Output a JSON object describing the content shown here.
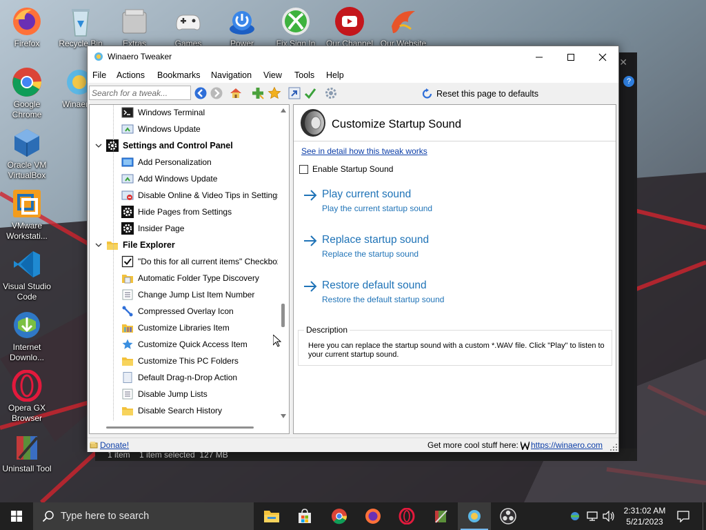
{
  "desktop": {
    "icons": [
      {
        "label": "Firefox",
        "icon": "firefox-icon"
      },
      {
        "label": "Recycle Bin",
        "icon": "recycle-bin-icon"
      },
      {
        "label": "Extras",
        "icon": "extras-icon"
      },
      {
        "label": "Games",
        "icon": "games-icon"
      },
      {
        "label": "Power",
        "icon": "power-icon"
      },
      {
        "label": "Fix Sign In",
        "icon": "xbox-icon"
      },
      {
        "label": "Our Channel",
        "icon": "youtube-icon"
      },
      {
        "label": "Our Website",
        "icon": "phoenix-icon"
      },
      {
        "label": "Google Chrome",
        "icon": "chrome-icon"
      },
      {
        "label": "Winaero Tweaker",
        "icon": "winaero-icon"
      },
      {
        "label": "Oracle VM VirtualBox",
        "icon": "virtualbox-icon"
      },
      {
        "label": "VMware Workstati...",
        "icon": "vmware-icon"
      },
      {
        "label": "Visual Studio Code",
        "icon": "vscode-icon"
      },
      {
        "label": "Internet Downlo...",
        "icon": "idm-icon"
      },
      {
        "label": "Opera GX Browser",
        "icon": "opera-gx-icon"
      },
      {
        "label": "Uninstall Tool",
        "icon": "uninstall-tool-icon"
      }
    ]
  },
  "background_window": {
    "status": "1 item    1 item selected  127 MB"
  },
  "window": {
    "title": "Winaero Tweaker",
    "menu": [
      "File",
      "Actions",
      "Bookmarks",
      "Navigation",
      "View",
      "Tools",
      "Help"
    ],
    "search_placeholder": "Search for a tweak...",
    "reset_label": "Reset this page to defaults",
    "tree": [
      {
        "label": "Windows Terminal",
        "type": "item",
        "icon": "terminal-icon"
      },
      {
        "label": "Windows Update",
        "type": "item",
        "icon": "windows-update-icon"
      },
      {
        "label": "Settings and Control Panel",
        "type": "category",
        "icon": "gear-icon"
      },
      {
        "label": "Add Personalization",
        "type": "item",
        "icon": "personalization-icon"
      },
      {
        "label": "Add Windows Update",
        "type": "item",
        "icon": "windows-update-icon"
      },
      {
        "label": "Disable Online & Video Tips in Settings",
        "type": "item",
        "icon": "tips-icon"
      },
      {
        "label": "Hide Pages from Settings",
        "type": "item",
        "icon": "gear-icon"
      },
      {
        "label": "Insider Page",
        "type": "item",
        "icon": "gear-icon"
      },
      {
        "label": "File Explorer",
        "type": "category",
        "icon": "folder-icon"
      },
      {
        "label": "\"Do this for all current items\" Checkbox",
        "type": "item",
        "icon": "checkbox-icon"
      },
      {
        "label": "Automatic Folder Type Discovery",
        "type": "item",
        "icon": "folder-discovery-icon"
      },
      {
        "label": "Change Jump List Item Number",
        "type": "item",
        "icon": "list-icon"
      },
      {
        "label": "Compressed Overlay Icon",
        "type": "item",
        "icon": "compressed-icon"
      },
      {
        "label": "Customize Libraries Item",
        "type": "item",
        "icon": "libraries-icon"
      },
      {
        "label": "Customize Quick Access Item",
        "type": "item",
        "icon": "star-icon"
      },
      {
        "label": "Customize This PC Folders",
        "type": "item",
        "icon": "folder-icon"
      },
      {
        "label": "Default Drag-n-Drop Action",
        "type": "item",
        "icon": "page-icon"
      },
      {
        "label": "Disable Jump Lists",
        "type": "item",
        "icon": "list-icon"
      },
      {
        "label": "Disable Search History",
        "type": "item",
        "icon": "folder-icon"
      }
    ],
    "page": {
      "title": "Customize Startup Sound",
      "detail_link": "See in detail how this tweak works",
      "enable_label": "Enable Startup Sound",
      "enable_checked": false,
      "actions": [
        {
          "title": "Play current sound",
          "subtitle": "Play the current startup sound"
        },
        {
          "title": "Replace startup sound",
          "subtitle": "Replace the startup sound"
        },
        {
          "title": "Restore default sound",
          "subtitle": "Restore the default startup sound"
        }
      ],
      "description_label": "Description",
      "description": "Here you can replace the startup sound with a custom *.WAV file. Click \"Play\" to listen to your current startup sound."
    },
    "status": {
      "donate": "Donate!",
      "more": "Get more cool stuff here:",
      "link": "https://winaero.com"
    }
  },
  "taskbar": {
    "search_placeholder": "Type here to search",
    "time": "2:31:02 AM",
    "date": "5/21/2023"
  },
  "colors": {
    "accent_link": "#1f73b7",
    "hyperlink": "#0c3ea8",
    "taskbar": "#202020"
  }
}
